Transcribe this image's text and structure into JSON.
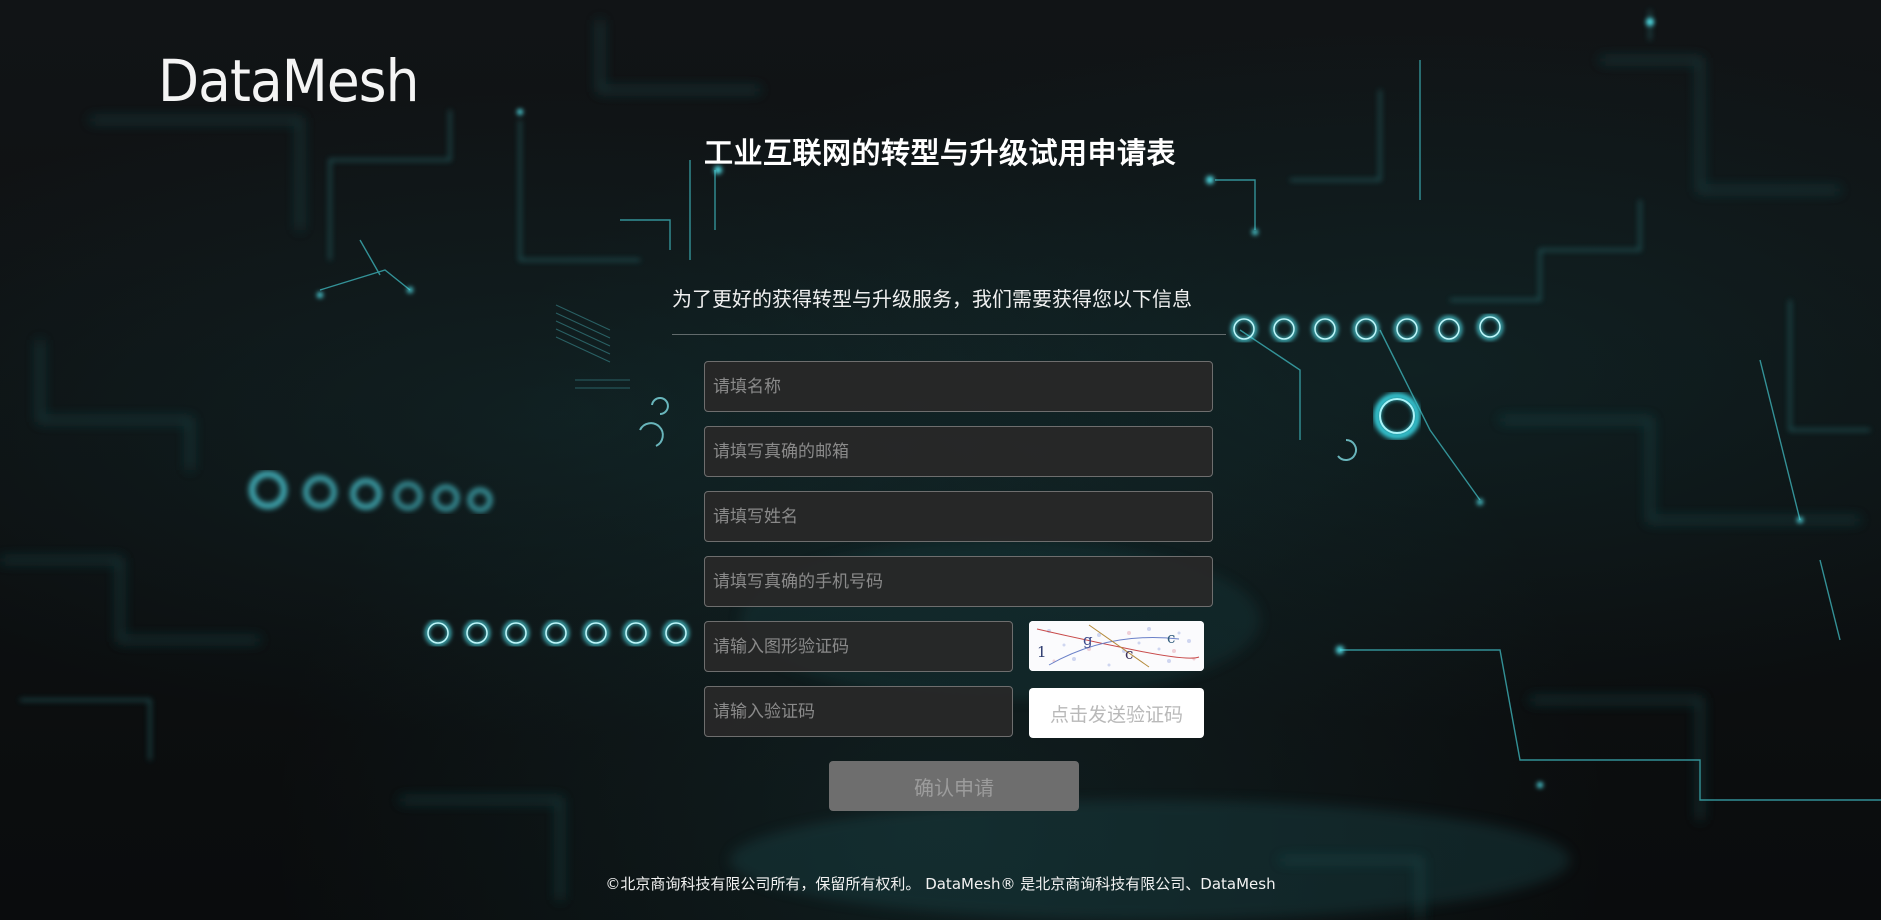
{
  "brand": {
    "logo_text": "DataMesh"
  },
  "form": {
    "title": "工业互联网的转型与升级试用申请表",
    "intro": "为了更好的获得转型与升级服务，我们需要获得您以下信息",
    "fields": {
      "name_placeholder": "请填名称",
      "email_placeholder": "请填写真确的邮箱",
      "fullname_placeholder": "请填写姓名",
      "phone_placeholder": "请填写真确的手机号码",
      "image_code_placeholder": "请输入图形验证码",
      "sms_code_placeholder": "请输入验证码"
    },
    "captcha_text": "1 g c c",
    "send_code_label": "点击发送验证码",
    "submit_label": "确认申请"
  },
  "footer": {
    "text": "©北京商询科技有限公司所有，保留所有权利。 DataMesh® 是北京商询科技有限公司、DataMesh"
  },
  "colors": {
    "background": "#0b0d0e",
    "accent_cyan": "#3fd6e0",
    "field_bg": "#282828",
    "field_border": "#6e6e6e",
    "submit_bg": "#6e6e6e"
  }
}
